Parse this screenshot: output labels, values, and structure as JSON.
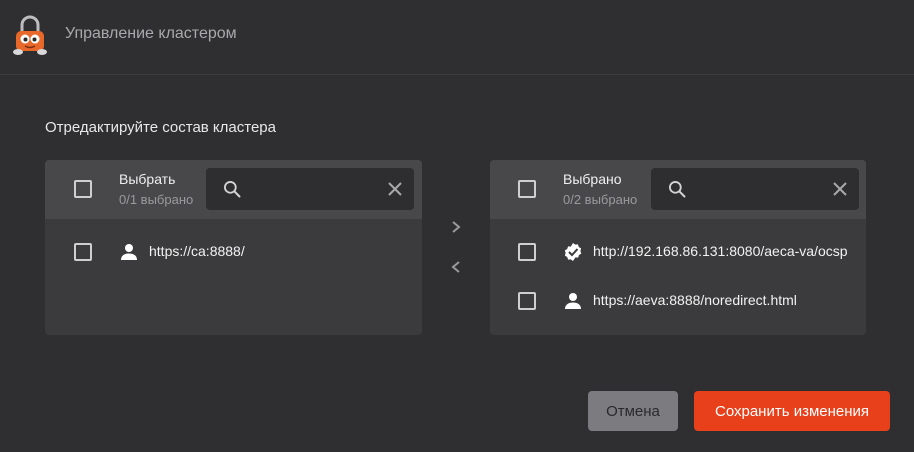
{
  "window": {
    "title": "Управление кластером"
  },
  "section": {
    "title": "Отредактируйте состав кластера"
  },
  "available": {
    "title": "Выбрать",
    "count": "0/1 выбрано",
    "search_placeholder": "",
    "items": [
      {
        "label": "https://ca:8888/",
        "icon": "user-icon"
      }
    ]
  },
  "selected": {
    "title": "Выбрано",
    "count": "0/2 выбрано",
    "search_placeholder": "",
    "items": [
      {
        "label": "http://192.168.86.131:8080/aeca-va/ocsp",
        "icon": "verified-badge-icon"
      },
      {
        "label": "https://aeva:8888/noredirect.html",
        "icon": "user-icon"
      }
    ]
  },
  "actions": {
    "cancel_label": "Отмена",
    "save_label": "Сохранить изменения"
  },
  "colors": {
    "background": "#2f2f31",
    "panel": "#3b3b3d",
    "panel_header": "#48484b",
    "accent": "#e8401b",
    "cancel": "#7c7c80"
  }
}
